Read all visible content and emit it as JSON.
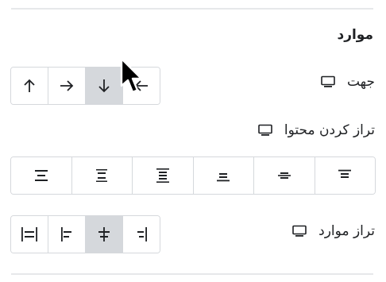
{
  "section": {
    "title": "موارد"
  },
  "direction": {
    "label": "جهت",
    "icon": "monitor-icon",
    "buttons": [
      {
        "name": "arrow-up",
        "glyph": "↑",
        "active": false
      },
      {
        "name": "arrow-right",
        "glyph": "→",
        "active": false
      },
      {
        "name": "arrow-down",
        "glyph": "↓",
        "active": true
      },
      {
        "name": "arrow-left",
        "glyph": "←",
        "active": false
      }
    ]
  },
  "justify_content": {
    "label": "تراز کردن محتوا",
    "icon": "monitor-icon",
    "buttons": [
      {
        "name": "justify-space-evenly",
        "active": false
      },
      {
        "name": "justify-space-around",
        "active": false
      },
      {
        "name": "justify-space-between",
        "active": false
      },
      {
        "name": "justify-end",
        "active": false
      },
      {
        "name": "justify-center",
        "active": false
      },
      {
        "name": "justify-start",
        "active": false
      }
    ]
  },
  "align_items": {
    "label": "تراز موارد",
    "icon": "monitor-icon",
    "buttons": [
      {
        "name": "align-stretch",
        "active": false
      },
      {
        "name": "align-end",
        "active": false
      },
      {
        "name": "align-center",
        "active": true
      },
      {
        "name": "align-start",
        "active": false
      }
    ]
  },
  "colors": {
    "active_bg": "#d5d8dc",
    "border": "#d5d8dc",
    "text": "#1f2124"
  }
}
